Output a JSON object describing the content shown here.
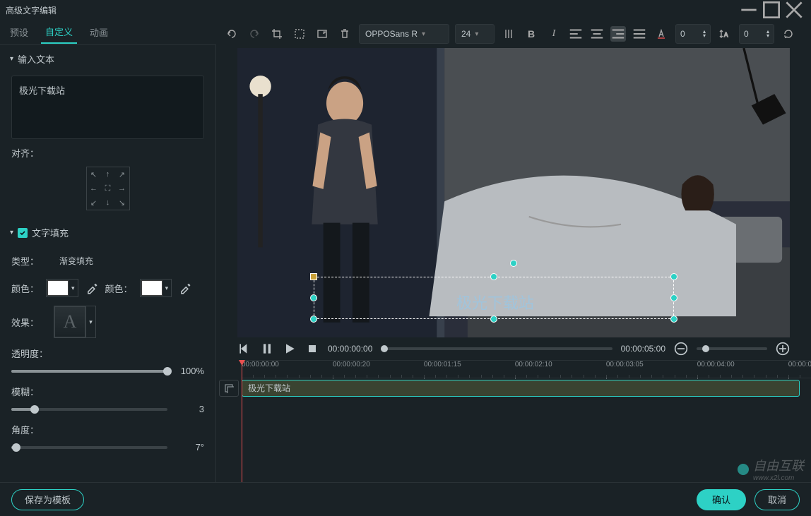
{
  "window": {
    "title": "高级文字编辑"
  },
  "tabs": {
    "preset": "预设",
    "custom": "自定义",
    "anim": "动画"
  },
  "toolbar": {
    "font": "OPPOSans R",
    "size": "24",
    "spacing": "0",
    "lineheight": "0"
  },
  "left": {
    "input_label": "输入文本",
    "text_value": "极光下载站",
    "align_label": "对齐：",
    "fill_label": "文字填充",
    "type_label": "类型：",
    "type_value": "渐变填充",
    "color1_label": "颜色：",
    "color2_label": "颜色：",
    "effect_label": "效果：",
    "effect_letter": "A",
    "opacity_label": "透明度：",
    "opacity_value": "100%",
    "blur_label": "模糊：",
    "blur_value": "3",
    "angle_label": "角度：",
    "angle_value": "7°"
  },
  "preview": {
    "overlay_text": "极光下载站",
    "time_current": "00:00:00:00",
    "time_total": "00:00:05:00"
  },
  "ruler": {
    "t0": "00:00:00:00",
    "t1": "00:00:00:20",
    "t2": "00:00:01:15",
    "t3": "00:00:02:10",
    "t4": "00:00:03:05",
    "t5": "00:00:04:00",
    "t6": "00:00:0"
  },
  "clip": {
    "label": "极光下载站"
  },
  "footer": {
    "save_template": "保存为模板",
    "confirm": "确认",
    "cancel": "取消"
  },
  "watermark": {
    "text": "自由互联",
    "url": "www.x2l.com"
  }
}
